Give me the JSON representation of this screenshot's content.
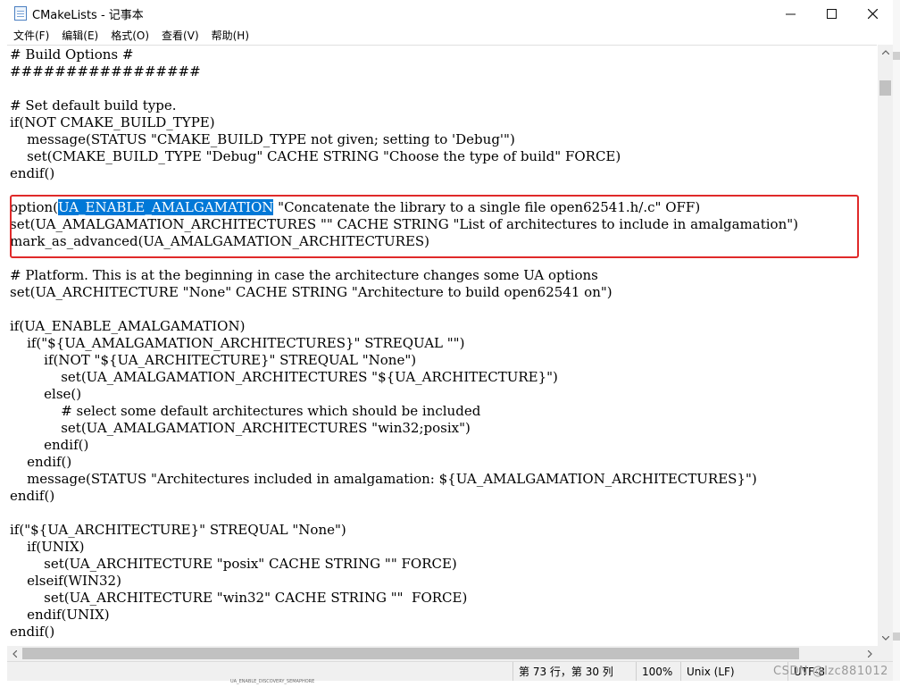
{
  "window": {
    "title": "CMakeLists - 记事本",
    "controls": {
      "minimize": "—",
      "maximize": "☐",
      "close": "✕"
    }
  },
  "menu": [
    {
      "label": "文件(F)"
    },
    {
      "label": "编辑(E)"
    },
    {
      "label": "格式(O)"
    },
    {
      "label": "查看(V)"
    },
    {
      "label": "帮助(H)"
    }
  ],
  "editor": {
    "selected_text": "UA_ENABLE_AMALGAMATION",
    "highlight_color": "#e02a2a",
    "selection_color": "#0078d7",
    "lines": [
      "# Build Options #",
      "#################",
      "",
      "# Set default build type.",
      "if(NOT CMAKE_BUILD_TYPE)",
      "    message(STATUS \"CMAKE_BUILD_TYPE not given; setting to 'Debug'\")",
      "    set(CMAKE_BUILD_TYPE \"Debug\" CACHE STRING \"Choose the type of build\" FORCE)",
      "endif()",
      "",
      "option(",
      "set(UA_AMALGAMATION_ARCHITECTURES \"\" CACHE STRING \"List of architectures to include in amalgamation\")",
      "mark_as_advanced(UA_AMALGAMATION_ARCHITECTURES)",
      "",
      "# Platform. This is at the beginning in case the architecture changes some UA options",
      "set(UA_ARCHITECTURE \"None\" CACHE STRING \"Architecture to build open62541 on\")",
      "",
      "if(UA_ENABLE_AMALGAMATION)",
      "    if(\"${UA_AMALGAMATION_ARCHITECTURES}\" STREQUAL \"\")",
      "        if(NOT \"${UA_ARCHITECTURE}\" STREQUAL \"None\")",
      "            set(UA_AMALGAMATION_ARCHITECTURES \"${UA_ARCHITECTURE}\")",
      "        else()",
      "            # select some default architectures which should be included",
      "            set(UA_AMALGAMATION_ARCHITECTURES \"win32;posix\")",
      "        endif()",
      "    endif()",
      "    message(STATUS \"Architectures included in amalgamation: ${UA_AMALGAMATION_ARCHITECTURES}\")",
      "endif()",
      "",
      "if(\"${UA_ARCHITECTURE}\" STREQUAL \"None\")",
      "    if(UNIX)",
      "        set(UA_ARCHITECTURE \"posix\" CACHE STRING \"\" FORCE)",
      "    elseif(WIN32)",
      "        set(UA_ARCHITECTURE \"win32\" CACHE STRING \"\"  FORCE)",
      "    endif(UNIX)",
      "endif()"
    ],
    "option_line_suffix": " \"Concatenate the library to a single file open62541.h/.c\" OFF)"
  },
  "status": {
    "position": "第 73 行，第 30 列",
    "zoom": "100%",
    "line_ending": "Unix (LF)",
    "encoding": "UTF-8"
  },
  "watermark": "CSDN @lzc881012",
  "ghost_text": "UA_ENABLE_DISCOVERY_SEMAPHORE"
}
